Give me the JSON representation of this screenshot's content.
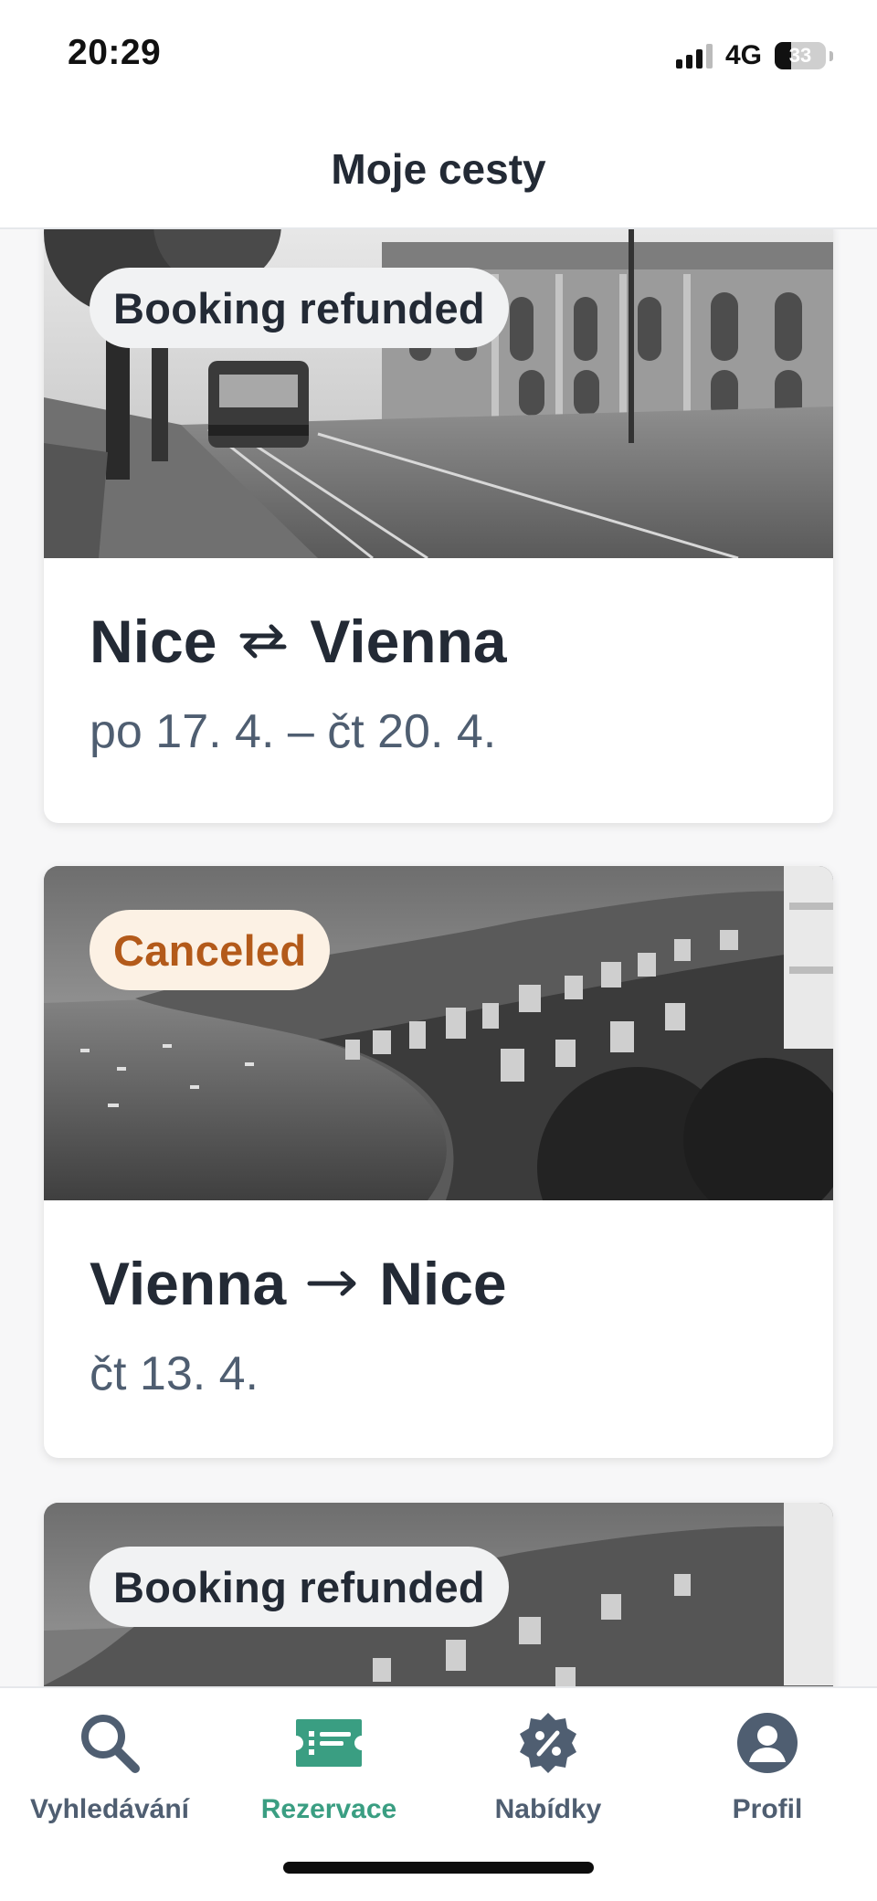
{
  "status_bar": {
    "time": "20:29",
    "network": "4G",
    "battery_percent": "33",
    "battery_level": 0.33
  },
  "header": {
    "title": "Moje cesty"
  },
  "trips": [
    {
      "status": "Booking refunded",
      "status_type": "refunded",
      "origin": "Nice",
      "destination": "Vienna",
      "trip_type": "return",
      "dates": "po 17. 4. – čt 20. 4.",
      "image": "vienna-street-tram-photo"
    },
    {
      "status": "Canceled",
      "status_type": "canceled",
      "origin": "Vienna",
      "destination": "Nice",
      "trip_type": "one-way",
      "dates": "čt 13. 4.",
      "image": "nice-coastline-photo"
    },
    {
      "status": "Booking refunded",
      "status_type": "refunded",
      "image": "nice-coastline-photo"
    }
  ],
  "tab_bar": {
    "items": [
      {
        "label": "Vyhledávání",
        "icon": "search-icon",
        "active": false
      },
      {
        "label": "Rezervace",
        "icon": "ticket-icon",
        "active": true
      },
      {
        "label": "Nabídky",
        "icon": "discount-badge-icon",
        "active": false
      },
      {
        "label": "Profil",
        "icon": "profile-icon",
        "active": false
      }
    ]
  },
  "colors": {
    "text_primary": "#232a35",
    "text_secondary": "#4f5e71",
    "accent_active": "#3a9e82",
    "canceled_text": "#b35a1a",
    "canceled_bg": "#fcf1e4",
    "refunded_bg": "#f1f2f3"
  }
}
